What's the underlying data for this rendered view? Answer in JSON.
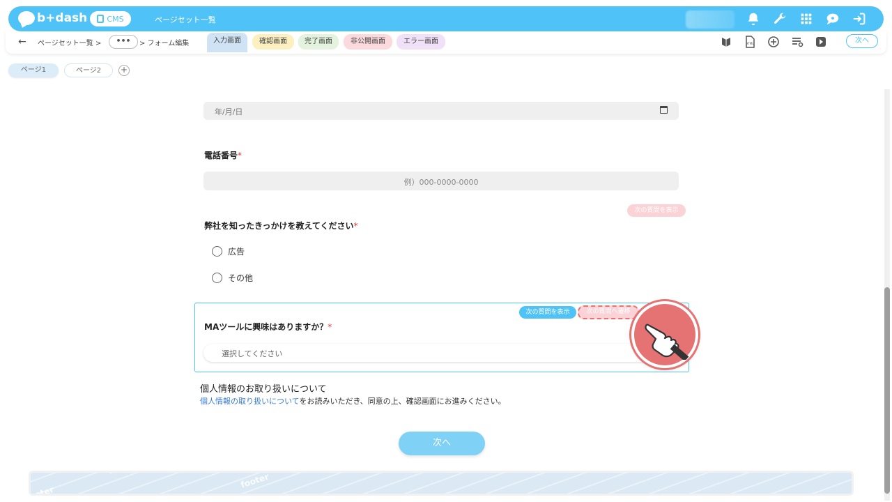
{
  "header": {
    "logo_text": "b+dash",
    "cms_label": "CMS",
    "title": "ページセット一覧",
    "icons": [
      "bell-icon",
      "wrench-icon",
      "grid-icon",
      "chat-icon",
      "logout-icon"
    ]
  },
  "subbar": {
    "breadcrumb_1": "ページセット一覧 >",
    "breadcrumb_more": "•••",
    "breadcrumb_2": "> フォーム編集",
    "tabs": [
      {
        "label": "入力画面",
        "color": "#cfe3f5"
      },
      {
        "label": "確認画面",
        "color": "#fdf0c0"
      },
      {
        "label": "完了画面",
        "color": "#e3f3dd"
      },
      {
        "label": "非公開画面",
        "color": "#fbd9dd"
      },
      {
        "label": "エラー画面",
        "color": "#f0e1f8"
      }
    ],
    "right_icons": [
      "beginner-mark-icon",
      "html-file-icon",
      "add-circle-icon",
      "list-settings-icon",
      "play-icon"
    ],
    "next_label": "次へ"
  },
  "pages": {
    "page1": "ページ1",
    "page2": "ページ2",
    "add": "+"
  },
  "form": {
    "date_placeholder": "年/月/日",
    "phone_label": "電話番号",
    "phone_placeholder": "例）000-0000-0000",
    "required_mark": "*",
    "tag_show_next_1": "次の質問を表示",
    "referral_label": "弊社を知ったきっかけを教えてください",
    "referral_options": [
      "広告",
      "その他"
    ],
    "tag_show_next_2": "次の質問を表示",
    "tag_goto_next": "次の質問へ遷移",
    "ma_label": "MAツールに興味はありますか？",
    "ma_placeholder": "選択してください",
    "privacy_title": "個人情報のお取り扱いについて",
    "privacy_link": "個人情報の取り扱いについて",
    "privacy_text": "をお読みいただき、同意の上、確認画面にお進みください。",
    "submit_label": "次へ"
  },
  "footer": {
    "word": "footer"
  },
  "colors": {
    "accent": "#4fc3f7",
    "required": "#e53935",
    "tag_pink": "#f8c6cb",
    "tag_blue": "#4fc3f7",
    "hand_circle": "#e57373"
  }
}
